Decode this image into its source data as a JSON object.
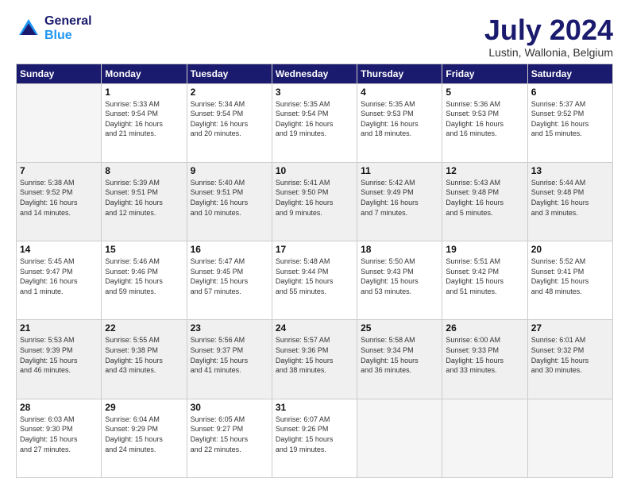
{
  "logo": {
    "line1": "General",
    "line2": "Blue"
  },
  "title": "July 2024",
  "location": "Lustin, Wallonia, Belgium",
  "days_of_week": [
    "Sunday",
    "Monday",
    "Tuesday",
    "Wednesday",
    "Thursday",
    "Friday",
    "Saturday"
  ],
  "weeks": [
    [
      {
        "day": "",
        "info": ""
      },
      {
        "day": "1",
        "info": "Sunrise: 5:33 AM\nSunset: 9:54 PM\nDaylight: 16 hours\nand 21 minutes."
      },
      {
        "day": "2",
        "info": "Sunrise: 5:34 AM\nSunset: 9:54 PM\nDaylight: 16 hours\nand 20 minutes."
      },
      {
        "day": "3",
        "info": "Sunrise: 5:35 AM\nSunset: 9:54 PM\nDaylight: 16 hours\nand 19 minutes."
      },
      {
        "day": "4",
        "info": "Sunrise: 5:35 AM\nSunset: 9:53 PM\nDaylight: 16 hours\nand 18 minutes."
      },
      {
        "day": "5",
        "info": "Sunrise: 5:36 AM\nSunset: 9:53 PM\nDaylight: 16 hours\nand 16 minutes."
      },
      {
        "day": "6",
        "info": "Sunrise: 5:37 AM\nSunset: 9:52 PM\nDaylight: 16 hours\nand 15 minutes."
      }
    ],
    [
      {
        "day": "7",
        "info": "Sunrise: 5:38 AM\nSunset: 9:52 PM\nDaylight: 16 hours\nand 14 minutes."
      },
      {
        "day": "8",
        "info": "Sunrise: 5:39 AM\nSunset: 9:51 PM\nDaylight: 16 hours\nand 12 minutes."
      },
      {
        "day": "9",
        "info": "Sunrise: 5:40 AM\nSunset: 9:51 PM\nDaylight: 16 hours\nand 10 minutes."
      },
      {
        "day": "10",
        "info": "Sunrise: 5:41 AM\nSunset: 9:50 PM\nDaylight: 16 hours\nand 9 minutes."
      },
      {
        "day": "11",
        "info": "Sunrise: 5:42 AM\nSunset: 9:49 PM\nDaylight: 16 hours\nand 7 minutes."
      },
      {
        "day": "12",
        "info": "Sunrise: 5:43 AM\nSunset: 9:48 PM\nDaylight: 16 hours\nand 5 minutes."
      },
      {
        "day": "13",
        "info": "Sunrise: 5:44 AM\nSunset: 9:48 PM\nDaylight: 16 hours\nand 3 minutes."
      }
    ],
    [
      {
        "day": "14",
        "info": "Sunrise: 5:45 AM\nSunset: 9:47 PM\nDaylight: 16 hours\nand 1 minute."
      },
      {
        "day": "15",
        "info": "Sunrise: 5:46 AM\nSunset: 9:46 PM\nDaylight: 15 hours\nand 59 minutes."
      },
      {
        "day": "16",
        "info": "Sunrise: 5:47 AM\nSunset: 9:45 PM\nDaylight: 15 hours\nand 57 minutes."
      },
      {
        "day": "17",
        "info": "Sunrise: 5:48 AM\nSunset: 9:44 PM\nDaylight: 15 hours\nand 55 minutes."
      },
      {
        "day": "18",
        "info": "Sunrise: 5:50 AM\nSunset: 9:43 PM\nDaylight: 15 hours\nand 53 minutes."
      },
      {
        "day": "19",
        "info": "Sunrise: 5:51 AM\nSunset: 9:42 PM\nDaylight: 15 hours\nand 51 minutes."
      },
      {
        "day": "20",
        "info": "Sunrise: 5:52 AM\nSunset: 9:41 PM\nDaylight: 15 hours\nand 48 minutes."
      }
    ],
    [
      {
        "day": "21",
        "info": "Sunrise: 5:53 AM\nSunset: 9:39 PM\nDaylight: 15 hours\nand 46 minutes."
      },
      {
        "day": "22",
        "info": "Sunrise: 5:55 AM\nSunset: 9:38 PM\nDaylight: 15 hours\nand 43 minutes."
      },
      {
        "day": "23",
        "info": "Sunrise: 5:56 AM\nSunset: 9:37 PM\nDaylight: 15 hours\nand 41 minutes."
      },
      {
        "day": "24",
        "info": "Sunrise: 5:57 AM\nSunset: 9:36 PM\nDaylight: 15 hours\nand 38 minutes."
      },
      {
        "day": "25",
        "info": "Sunrise: 5:58 AM\nSunset: 9:34 PM\nDaylight: 15 hours\nand 36 minutes."
      },
      {
        "day": "26",
        "info": "Sunrise: 6:00 AM\nSunset: 9:33 PM\nDaylight: 15 hours\nand 33 minutes."
      },
      {
        "day": "27",
        "info": "Sunrise: 6:01 AM\nSunset: 9:32 PM\nDaylight: 15 hours\nand 30 minutes."
      }
    ],
    [
      {
        "day": "28",
        "info": "Sunrise: 6:03 AM\nSunset: 9:30 PM\nDaylight: 15 hours\nand 27 minutes."
      },
      {
        "day": "29",
        "info": "Sunrise: 6:04 AM\nSunset: 9:29 PM\nDaylight: 15 hours\nand 24 minutes."
      },
      {
        "day": "30",
        "info": "Sunrise: 6:05 AM\nSunset: 9:27 PM\nDaylight: 15 hours\nand 22 minutes."
      },
      {
        "day": "31",
        "info": "Sunrise: 6:07 AM\nSunset: 9:26 PM\nDaylight: 15 hours\nand 19 minutes."
      },
      {
        "day": "",
        "info": ""
      },
      {
        "day": "",
        "info": ""
      },
      {
        "day": "",
        "info": ""
      }
    ]
  ]
}
